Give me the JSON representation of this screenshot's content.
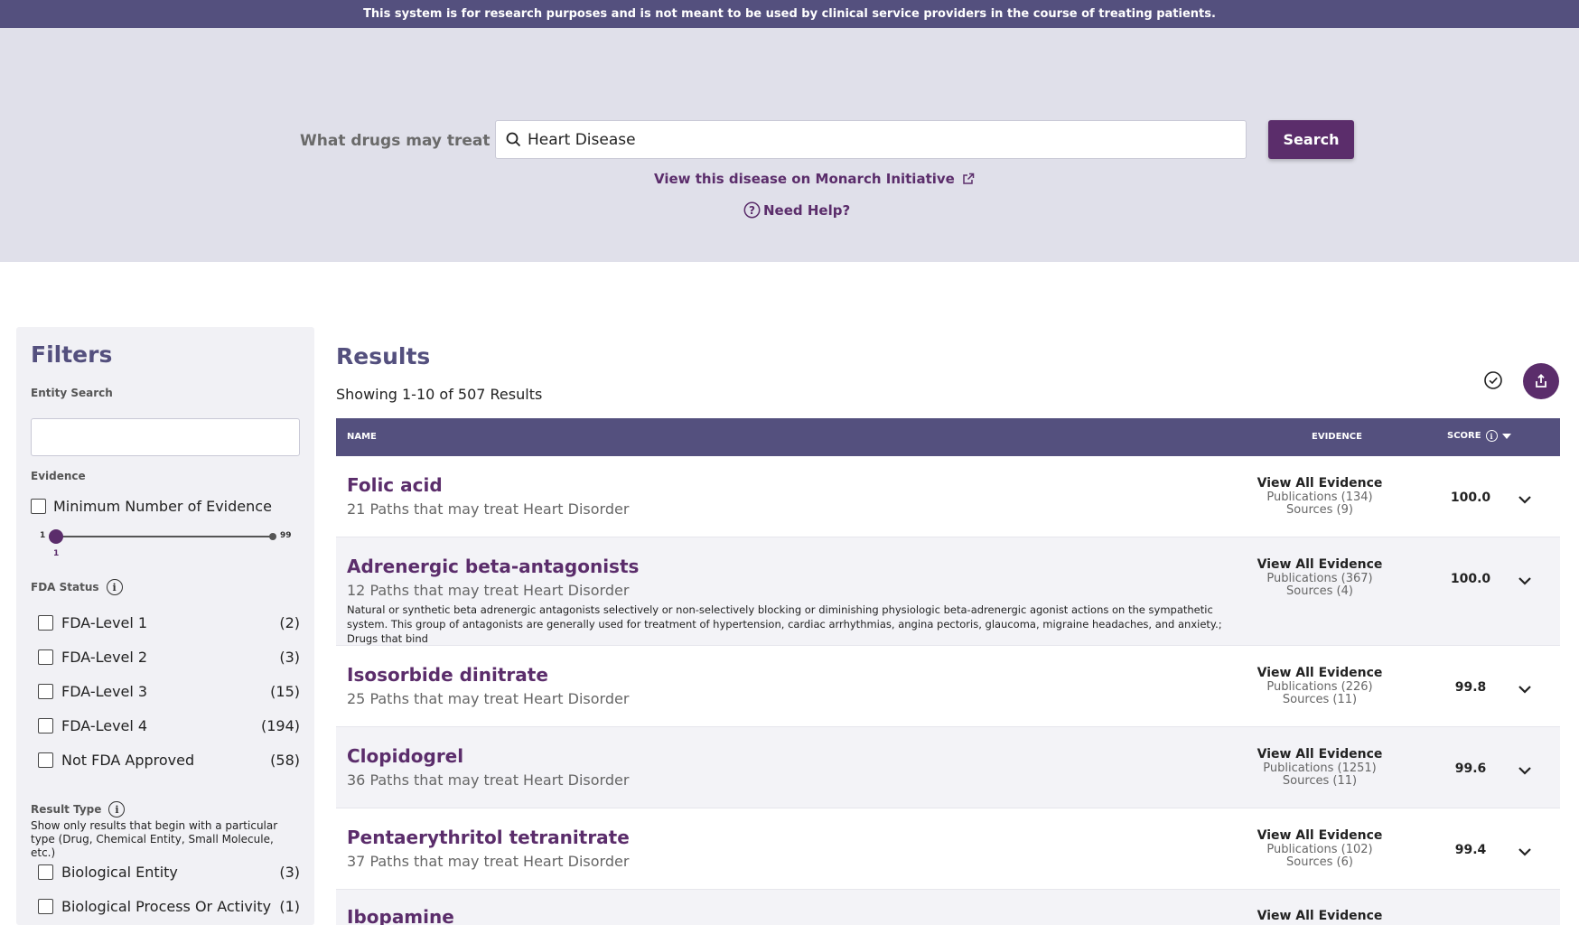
{
  "banner": "This system is for research purposes and is not meant to be used by clinical service providers in the course of treating patients.",
  "search": {
    "query_type": "What drugs may treat",
    "value": "Heart Disease",
    "button": "Search",
    "monarch_link": "View this disease on Monarch Initiative",
    "help_link": "Need Help?"
  },
  "filters": {
    "title": "Filters",
    "entity_search_label": "Entity Search",
    "entity_search_value": "",
    "evidence_label": "Evidence",
    "min_evidence_label": "Minimum Number of Evidence",
    "slider": {
      "min": "1",
      "max": "99",
      "value": "1"
    },
    "fda_status_label": "FDA Status",
    "fda_items": [
      {
        "label": "FDA-Level 1",
        "count": "(2)"
      },
      {
        "label": "FDA-Level 2",
        "count": "(3)"
      },
      {
        "label": "FDA-Level 3",
        "count": "(15)"
      },
      {
        "label": "FDA-Level 4",
        "count": "(194)"
      },
      {
        "label": "Not FDA Approved",
        "count": "(58)"
      }
    ],
    "result_type_label": "Result Type",
    "result_type_desc": "Show only results that begin with a particular type (Drug, Chemical Entity, Small Molecule, etc.)",
    "result_type_items": [
      {
        "label": "Biological Entity",
        "count": "(3)"
      },
      {
        "label": "Biological Process Or Activity",
        "count": "(1)"
      }
    ]
  },
  "results": {
    "title": "Results",
    "showing": "Showing 1-10 of 507 Results",
    "columns": {
      "name": "NAME",
      "evidence": "EVIDENCE",
      "score": "SCORE"
    },
    "view_all_label": "View All Evidence",
    "rows": [
      {
        "name": "Folic acid",
        "paths": "21 Paths that may treat Heart Disorder",
        "description": "",
        "publications": "Publications (134)",
        "sources": "Sources (9)",
        "score": "100.0"
      },
      {
        "name": "Adrenergic beta-antagonists",
        "paths": "12 Paths that may treat Heart Disorder",
        "description": "Natural or synthetic beta adrenergic antagonists selectively or non-selectively blocking or diminishing physiologic beta-adrenergic agonist actions on the sympathetic system. This group of antagonists are generally used for treatment of hypertension, cardiac arrhythmias, angina pectoris, glaucoma, migraine headaches, and anxiety.; Drugs that bind",
        "publications": "Publications (367)",
        "sources": "Sources (4)",
        "score": "100.0"
      },
      {
        "name": "Isosorbide dinitrate",
        "paths": "25 Paths that may treat Heart Disorder",
        "description": "",
        "publications": "Publications (226)",
        "sources": "Sources (11)",
        "score": "99.8"
      },
      {
        "name": "Clopidogrel",
        "paths": "36 Paths that may treat Heart Disorder",
        "description": "",
        "publications": "Publications (1251)",
        "sources": "Sources (11)",
        "score": "99.6"
      },
      {
        "name": "Pentaerythritol tetranitrate",
        "paths": "37 Paths that may treat Heart Disorder",
        "description": "",
        "publications": "Publications (102)",
        "sources": "Sources (6)",
        "score": "99.4"
      },
      {
        "name": "Ibopamine",
        "paths": "",
        "description": "",
        "publications": "",
        "sources": "",
        "score": ""
      }
    ]
  },
  "colors": {
    "brand_purple": "#5b2d6b",
    "header_purple": "#54507e",
    "hero_bg": "#e0e0ea"
  }
}
